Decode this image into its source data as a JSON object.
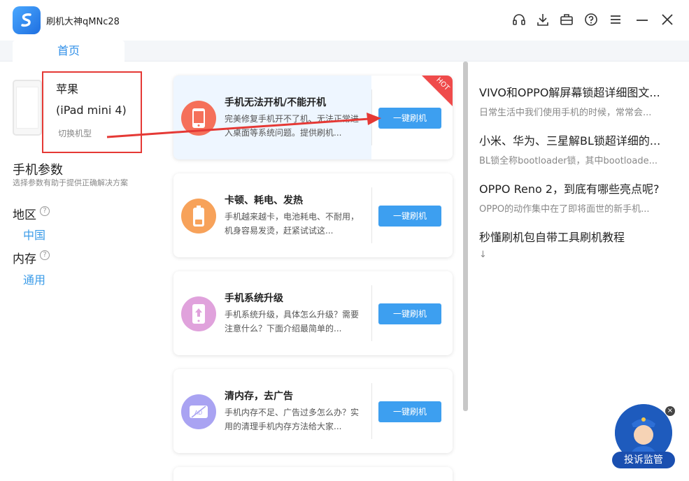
{
  "app": {
    "title": "刷机大神qMNc28"
  },
  "tabs": {
    "home": "首页"
  },
  "device": {
    "brand": "苹果",
    "model": "(iPad mini 4)",
    "switch_label": "切换机型"
  },
  "params": {
    "title": "手机参数",
    "subtitle": "选择参数有助于提供正确解决方案",
    "region_label": "地区",
    "region_value": "中国",
    "memory_label": "内存",
    "memory_value": "通用",
    "help_glyph": "?"
  },
  "cards": [
    {
      "title": "手机无法开机/不能开机",
      "desc": "完美修复手机开不了机、无法正常进入桌面等系统问题。提供刷机...",
      "button": "一键刷机",
      "badge": "HOT",
      "icon": "phone-icon",
      "color": "#f5705a"
    },
    {
      "title": "卡顿、耗电、发热",
      "desc": "手机越来越卡，电池耗电、不耐用，机身容易发烫，赶紧试试这...",
      "button": "一键刷机",
      "icon": "battery-icon",
      "color": "#f7a25a"
    },
    {
      "title": "手机系统升级",
      "desc": "手机系统升级，具体怎么升级？需要注意什么？下面介绍最简单的...",
      "button": "一键刷机",
      "icon": "upgrade-icon",
      "color": "#e0a2dc"
    },
    {
      "title": "清内存，去广告",
      "desc": "手机内存不足、广告过多怎么办？实用的清理手机内存方法给大家...",
      "button": "一键刷机",
      "icon": "no-ad-icon",
      "color": "#a9a3f2"
    }
  ],
  "articles": [
    {
      "title": "VIVO和OPPO解屏幕锁超详细图文...",
      "desc": "日常生活中我们使用手机的时候，常常会..."
    },
    {
      "title": "小米、华为、三星解BL锁超详细的...",
      "desc": "BL锁全称bootloader锁，其中bootloade..."
    },
    {
      "title": "OPPO Reno 2，到底有哪些亮点呢?",
      "desc": "OPPO的动作集中在了即将面世的新手机..."
    },
    {
      "title": "秒懂刷机包自带工具刷机教程",
      "desc": "↓"
    }
  ],
  "complaint": {
    "label": "投诉监管",
    "close": "×"
  }
}
